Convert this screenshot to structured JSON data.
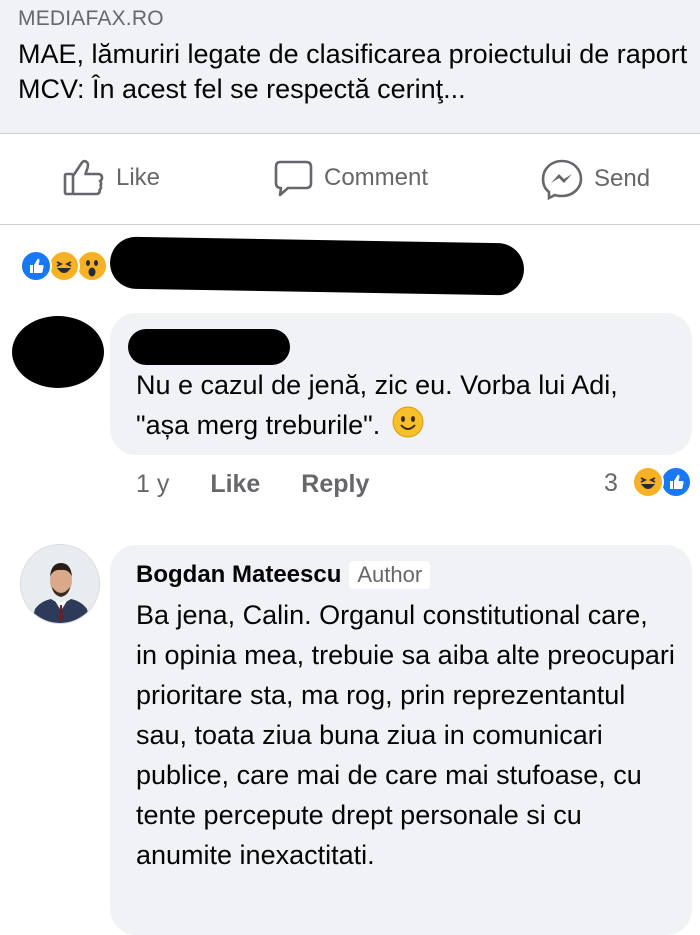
{
  "link_preview": {
    "source": "MEDIAFAX.RO",
    "headline": "MAE, lămuriri legate de clasificarea proiectului de raport MCV: În acest fel se respectă cerinţ..."
  },
  "actions": {
    "like": "Like",
    "comment": "Comment",
    "send": "Send"
  },
  "comments": [
    {
      "text": "Nu e cazul de jenă, zic eu. Vorba lui Adi, \"așa merg treburile\".",
      "time": "1 y",
      "like": "Like",
      "reply": "Reply",
      "reaction_count": "3"
    },
    {
      "author": "Bogdan Mateescu",
      "badge": "Author",
      "text": "Ba jena, Calin. Organul constitutional care, in opinia mea, trebuie sa aiba alte preocupari prioritare sta, ma rog, prin reprezentantul sau, toata ziua buna ziua in comunicari publice, care mai de care mai stufoase, cu tente percepute drept personale si cu anumite inexactitati."
    }
  ],
  "colors": {
    "like_blue": "#1877f2",
    "haha_yellow": "#f7b125",
    "muted_text": "#65676b",
    "bubble_bg": "#f0f2f5"
  },
  "icons": [
    "like-icon",
    "comment-icon",
    "messenger-icon",
    "like-reaction-icon",
    "haha-reaction-icon",
    "wow-reaction-icon",
    "smile-emoji-icon"
  ]
}
